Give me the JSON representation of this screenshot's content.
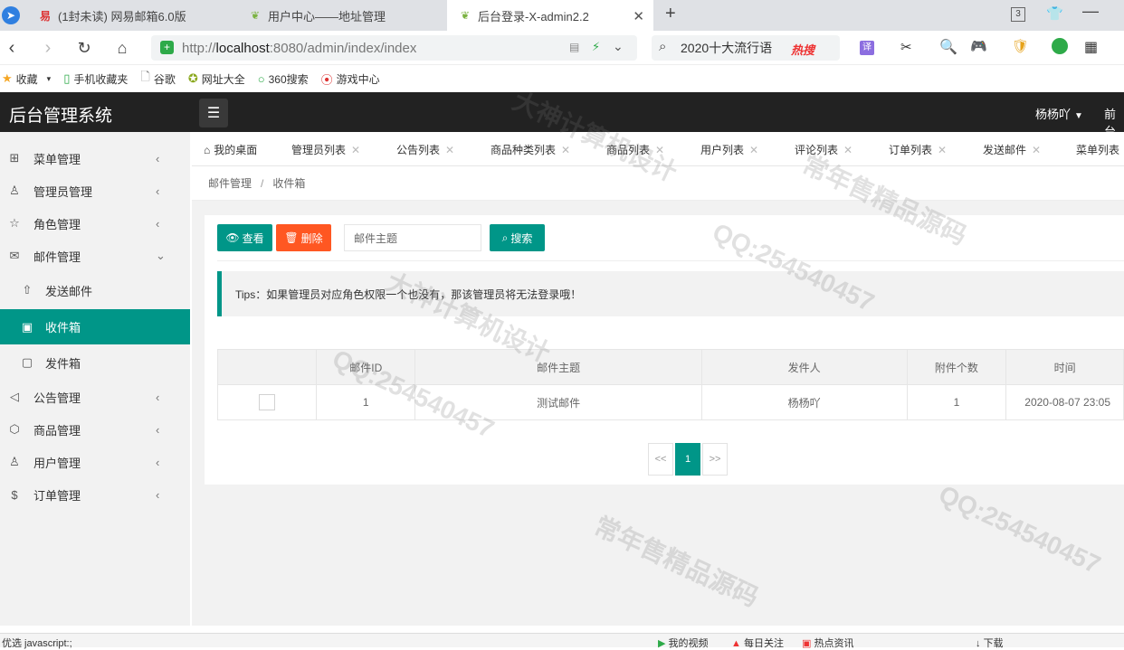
{
  "browser": {
    "tabs": [
      {
        "title": "(1封未读) 网易邮箱6.0版",
        "icon": "netease-mail-icon"
      },
      {
        "title": "用户中心——地址管理",
        "icon": "leaf-icon"
      },
      {
        "title": "后台登录-X-admin2.2",
        "icon": "leaf-icon"
      }
    ],
    "new_tab": "+",
    "tab_count": "3",
    "url_prefix": "http://",
    "url_host": "localhost",
    "url_path": ":8080/admin/index/index",
    "search_text": "2020十大流行语",
    "search_badge": "热搜",
    "bookmarks": [
      "收藏",
      "手机收藏夹",
      "谷歌",
      "网址大全",
      "360搜索",
      "游戏中心"
    ]
  },
  "app": {
    "title": "后台管理系统",
    "username": "杨杨吖",
    "front_link": "前台"
  },
  "sidebar": {
    "items": [
      {
        "label": "菜单管理",
        "icon": "grid-icon"
      },
      {
        "label": "管理员管理",
        "icon": "user-icon"
      },
      {
        "label": "角色管理",
        "icon": "star-icon"
      },
      {
        "label": "邮件管理",
        "icon": "mail-icon"
      },
      {
        "label": "发送邮件",
        "icon": "upload-icon"
      },
      {
        "label": "收件箱",
        "icon": "inbox-icon"
      },
      {
        "label": "发件箱",
        "icon": "outbox-icon"
      },
      {
        "label": "公告管理",
        "icon": "speaker-icon"
      },
      {
        "label": "商品管理",
        "icon": "box-icon"
      },
      {
        "label": "用户管理",
        "icon": "user-icon"
      },
      {
        "label": "订单管理",
        "icon": "dollar-icon"
      }
    ]
  },
  "page_tabs": [
    "我的桌面",
    "管理员列表",
    "公告列表",
    "商品种类列表",
    "商品列表",
    "用户列表",
    "评论列表",
    "订单列表",
    "发送邮件",
    "菜单列表"
  ],
  "breadcrumb": {
    "parent": "邮件管理",
    "sep": "/",
    "current": "收件箱"
  },
  "toolbar": {
    "view_label": "查看",
    "delete_label": "删除",
    "search_placeholder": "邮件主题",
    "search_label": "搜索"
  },
  "tips": "Tips：如果管理员对应角色权限一个也没有，那该管理员将无法登录哦！",
  "table": {
    "headers": [
      "",
      "邮件ID",
      "邮件主题",
      "发件人",
      "附件个数",
      "时间"
    ],
    "rows": [
      {
        "id": "1",
        "subject": "测试邮件",
        "sender": "杨杨吖",
        "attachments": "1",
        "time": "2020-08-07 23:05"
      }
    ]
  },
  "pagination": {
    "prev": "<<",
    "current": "1",
    "next": ">>"
  },
  "status": {
    "left": "优选  javascript:;",
    "items": [
      "我的视频",
      "每日关注",
      "热点资讯",
      "下载"
    ]
  },
  "watermarks": [
    "QQ:254540457",
    "常年售精品源码",
    "大神计算机设计"
  ]
}
